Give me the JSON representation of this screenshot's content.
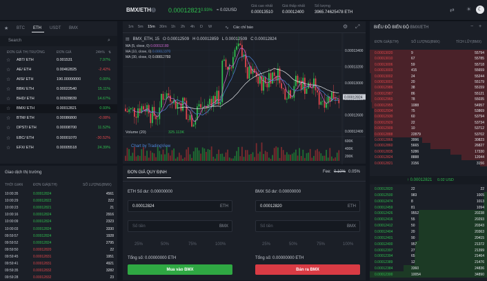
{
  "header": {
    "pair": "BMX/ETH",
    "price": "0.00012821",
    "change": "0.93%",
    "approx": "≈ 0.02USD",
    "high_label": "Giá cao nhất",
    "high": "0.00013510",
    "low_label": "Giá thấp nhất",
    "low": "0.00012400",
    "vol_label": "Số lượng",
    "vol": "3965.74625478 ETH"
  },
  "markets": {
    "tabs": [
      "BTC",
      "ETH",
      "USDT",
      "BMX"
    ],
    "search_placeholder": "Search",
    "col_pair": "ĐƠN GIÁ THỊ TRƯỜNG",
    "col_price": "ĐƠN GIÁ",
    "col_change": "24h%",
    "rows": [
      {
        "pair": "ABT/ ETH",
        "price": "0.001531",
        "change": "7.97%",
        "up": true
      },
      {
        "pair": "AE/ ETH",
        "price": "0.00462825",
        "change": "-2.42%",
        "up": false
      },
      {
        "pair": "AISI/ ETH",
        "price": "190.00000000",
        "change": "0.00%",
        "up": true
      },
      {
        "pair": "BBK/ ETH",
        "price": "0.00022540",
        "change": "15.11%",
        "up": true
      },
      {
        "pair": "BHD/ ETH",
        "price": "0.00928839",
        "change": "14.67%",
        "up": true
      },
      {
        "pair": "BMX/ ETH",
        "price": "0.00012821",
        "change": "0.93%",
        "up": true
      },
      {
        "pair": "BTM/ ETH",
        "price": "0.00086800",
        "change": "-0.08%",
        "up": false
      },
      {
        "pair": "DPST/ ETH",
        "price": "0.00008700",
        "change": "11.52%",
        "up": true
      },
      {
        "pair": "EBC/ ETH",
        "price": "0.00001070",
        "change": "-30.52%",
        "up": false
      },
      {
        "pair": "EFX/ ETH",
        "price": "0.00005518",
        "change": "24.39%",
        "up": true
      }
    ]
  },
  "trades": {
    "title": "Giao dịch thị trường",
    "col_time": "THỜI GIAN",
    "col_price": "ĐƠN GIÁ(ETH)",
    "col_qty": "SỐ LƯỢNG(BMX)",
    "rows": [
      [
        "10:00:35",
        "0.00012824",
        "4561",
        true
      ],
      [
        "10:00:29",
        "0.00012822",
        "222",
        true
      ],
      [
        "10:00:23",
        "0.00012821",
        "21",
        true
      ],
      [
        "10:00:16",
        "0.00012824",
        "2916",
        true
      ],
      [
        "10:00:09",
        "0.00012824",
        "2323",
        true
      ],
      [
        "10:00:03",
        "0.00012824",
        "3330",
        true
      ],
      [
        "09:59:57",
        "0.00012824",
        "1928",
        true
      ],
      [
        "09:59:52",
        "0.00012824",
        "2795",
        true
      ],
      [
        "09:59:50",
        "0.00012820",
        "22",
        false
      ],
      [
        "09:59:45",
        "0.00012831",
        "1951",
        false
      ],
      [
        "09:59:41",
        "0.00012831",
        "4921",
        false
      ],
      [
        "09:59:35",
        "0.00012832",
        "3282",
        false
      ],
      [
        "09:59:28",
        "0.00012832",
        "23",
        false
      ]
    ]
  },
  "chart": {
    "intervals": [
      "1m",
      "5m",
      "15m",
      "30m",
      "1h",
      "2h",
      "4h",
      "D",
      "W"
    ],
    "active": "15m",
    "indicators": "Các chỉ báo",
    "symbol": "BMX_ETH, 15",
    "o": "O 0.00012509",
    "h": "H 0.00012859",
    "l": "L 0.00012509",
    "c": "C 0.00012824",
    "ma5": "MA (5, close, 0)",
    "ma5v": "0.00013180",
    "ma10": "MA (10, close, 0)",
    "ma10v": "0.00013370",
    "ma30": "MA (30, close, 0)",
    "ma30v": "0.00012793",
    "yticks": [
      "0.00013400",
      "0.00013200",
      "0.00013000",
      "0.00012800",
      "0.00012600",
      "0.00012400"
    ],
    "last": "0.00012824",
    "volume": "Volume (20)",
    "volv": "325.113K",
    "vticks": [
      "600K",
      "400K",
      "200K"
    ],
    "xticks": [
      "12:00",
      "18:00",
      "13",
      "06:00",
      "11:0"
    ],
    "tv": "Chart by TradingView"
  },
  "order": {
    "tab": "ĐƠN GIÁ QUY ĐỊNH",
    "fee_label": "Fee:",
    "fee_old": "0.10%",
    "fee_new": "0.05%",
    "buy_bal": "ETH Số dư: 0.00000000",
    "sell_bal": "BMX Số dư: 0.00000000",
    "buy_price": "0.00012824",
    "sell_price": "0.00012820",
    "eth": "ETH",
    "bmx": "BMX",
    "qty_ph": "Số tiền",
    "pcts": [
      "25%",
      "50%",
      "75%",
      "100%"
    ],
    "total": "Tổng số: 0.00000000 ETH",
    "buy_btn": "Mua vào BMX",
    "sell_btn": "Bán ra BMX"
  },
  "orderbook": {
    "title": "BIỂU ĐỒ BIẾN ĐỘ",
    "pair": "BMX/ETH",
    "col_price": "ĐƠN GIÁ(ETH)",
    "col_qty": "SỐ LƯỢNG(BMX)",
    "col_total": "TÍCH LŨY(BMX)",
    "asks": [
      [
        "0.00013020",
        "9",
        "55794"
      ],
      [
        "0.00013010",
        "67",
        "55785"
      ],
      [
        "0.00013006",
        "59",
        "55718"
      ],
      [
        "0.00013003",
        "415",
        "55659"
      ],
      [
        "0.00013002",
        "24",
        "55244"
      ],
      [
        "0.00013001",
        "20",
        "55179"
      ],
      [
        "0.00012986",
        "38",
        "55159"
      ],
      [
        "0.00012987",
        "86",
        "55121"
      ],
      [
        "0.00012960",
        "78",
        "55035"
      ],
      [
        "0.00012955",
        "1088",
        "54957"
      ],
      [
        "0.00012934",
        "75",
        "53869"
      ],
      [
        "0.00012930",
        "60",
        "53794"
      ],
      [
        "0.00012929",
        "22",
        "53734"
      ],
      [
        "0.00012909",
        "10",
        "53712"
      ],
      [
        "0.00012888",
        "22879",
        "53702"
      ],
      [
        "0.00012866",
        "3996",
        "30823"
      ],
      [
        "0.00012860",
        "5665",
        "26827"
      ],
      [
        "0.00012835",
        "5286",
        "17330"
      ],
      [
        "0.00012824",
        "8888",
        "12044"
      ],
      [
        "0.00012821",
        "3156",
        "3156"
      ]
    ],
    "mid": "↑ 0.00012821",
    "mid_usd": "0.02 USD",
    "bids": [
      [
        "0.00012820",
        "22",
        "22"
      ],
      [
        "0.00012500",
        "983",
        "1005"
      ],
      [
        "0.00012474",
        "8",
        "1013"
      ],
      [
        "0.00012459",
        "81",
        "1094"
      ],
      [
        "0.00012426",
        "9552",
        "20238"
      ],
      [
        "0.00012416",
        "55",
        "20293"
      ],
      [
        "0.00012412",
        "50",
        "20343"
      ],
      [
        "0.00012404",
        "20",
        "20363"
      ],
      [
        "0.00012401",
        "90",
        "20415"
      ],
      [
        "0.00012400",
        "957",
        "21372"
      ],
      [
        "0.00012397",
        "27",
        "21399"
      ],
      [
        "0.00012394",
        "65",
        "21464"
      ],
      [
        "0.00012389",
        "12",
        "21476"
      ],
      [
        "0.00012384",
        "3360",
        "24836"
      ],
      [
        "0.00012300",
        "10054",
        "34890"
      ]
    ]
  }
}
